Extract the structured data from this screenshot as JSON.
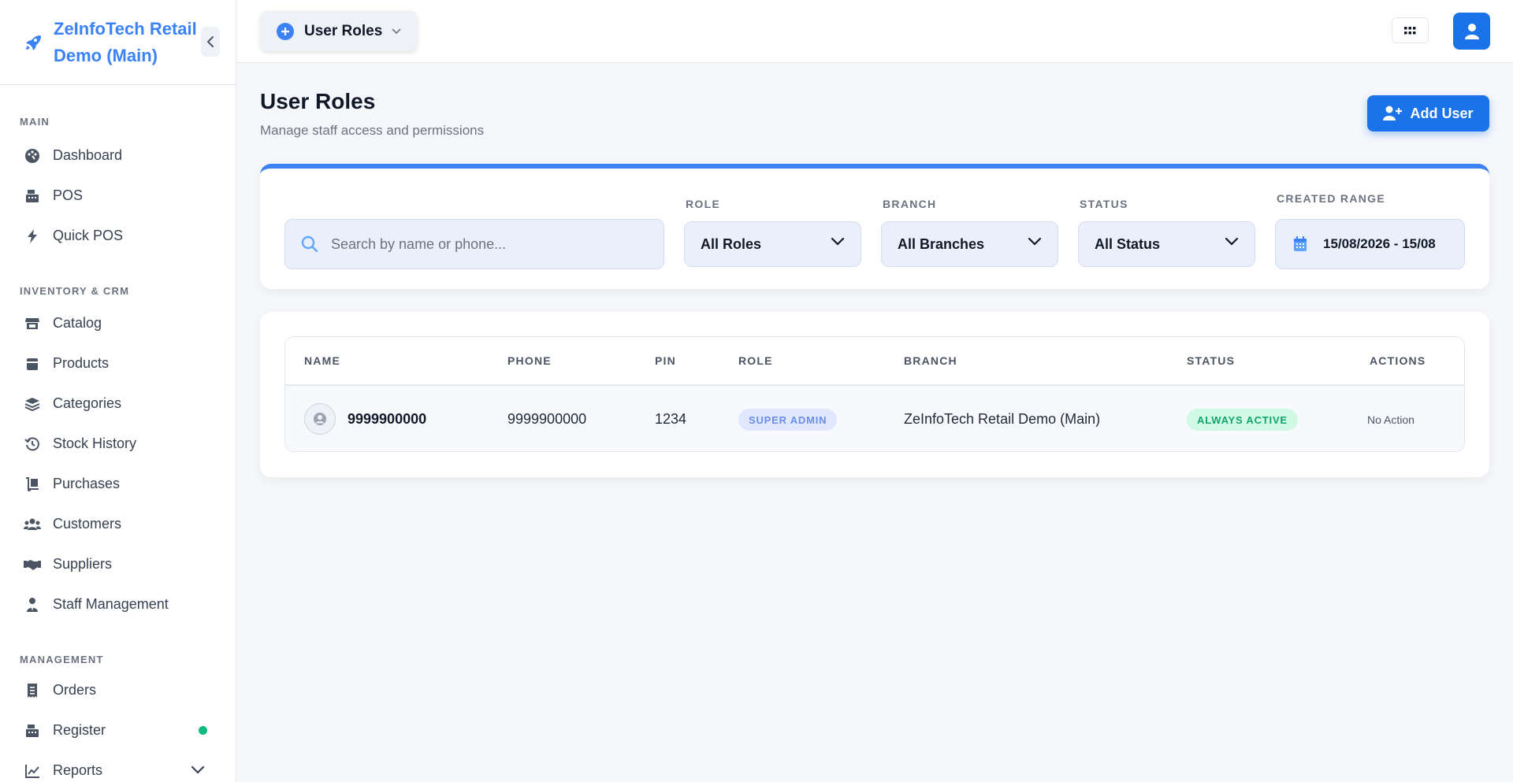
{
  "sidebar": {
    "brand_title": "ZeInfoTech Retail Demo (Main)",
    "sections": [
      {
        "label": "MAIN",
        "items": [
          {
            "label": "Dashboard",
            "icon": "palette-icon"
          },
          {
            "label": "POS",
            "icon": "cash-register-icon"
          },
          {
            "label": "Quick POS",
            "icon": "bolt-icon"
          }
        ]
      },
      {
        "label": "INVENTORY & CRM",
        "items": [
          {
            "label": "Catalog",
            "icon": "store-icon"
          },
          {
            "label": "Products",
            "icon": "box-icon"
          },
          {
            "label": "Categories",
            "icon": "layers-icon"
          },
          {
            "label": "Stock History",
            "icon": "history-icon"
          },
          {
            "label": "Purchases",
            "icon": "dolly-icon"
          },
          {
            "label": "Customers",
            "icon": "users-icon"
          },
          {
            "label": "Suppliers",
            "icon": "handshake-icon"
          },
          {
            "label": "Staff Management",
            "icon": "user-tie-icon"
          }
        ]
      },
      {
        "label": "MANAGEMENT",
        "items": [
          {
            "label": "Orders",
            "icon": "receipt-icon"
          },
          {
            "label": "Register",
            "icon": "cash-register-icon"
          },
          {
            "label": "Reports",
            "icon": "chart-line-icon"
          }
        ]
      }
    ]
  },
  "topbar": {
    "page_switch_label": "User Roles"
  },
  "header": {
    "title": "User Roles",
    "subtitle": "Manage staff access and permissions",
    "add_user_label": "Add User"
  },
  "filters": {
    "search_placeholder": "Search by name or phone...",
    "role_label": "ROLE",
    "role_value": "All Roles",
    "branch_label": "BRANCH",
    "branch_value": "All Branches",
    "status_label": "STATUS",
    "status_value": "All Status",
    "created_range_label": "CREATED RANGE",
    "created_range_value": "15/08/2026 - 15/08"
  },
  "table": {
    "columns": [
      "NAME",
      "PHONE",
      "PIN",
      "ROLE",
      "BRANCH",
      "STATUS",
      "ACTIONS"
    ],
    "rows": [
      {
        "name": "9999900000",
        "phone": "9999900000",
        "pin": "1234",
        "role": "SUPER ADMIN",
        "branch": "ZeInfoTech Retail Demo (Main)",
        "status": "ALWAYS ACTIVE",
        "actions": "No Action"
      }
    ]
  },
  "colors": {
    "accent": "#3b82f6",
    "primary_button": "#1a73e8",
    "status_green": "#10b981"
  }
}
